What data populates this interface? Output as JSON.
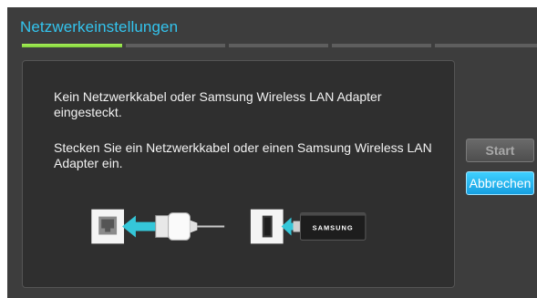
{
  "header": {
    "title": "Netzwerkeinstellungen",
    "progress": {
      "total_steps": 5,
      "current_step": 1
    }
  },
  "message": {
    "line1": "Kein Netzwerkkabel oder Samsung Wireless LAN Adapter eingesteckt.",
    "line2": "Stecken Sie ein Netzwerkkabel oder einen Samsung Wireless LAN Adapter ein."
  },
  "illustration": {
    "adapter_brand": "SAMSUNG",
    "icons": [
      "ethernet-port-icon",
      "network-cable-icon",
      "usb-port-icon",
      "wireless-lan-adapter-icon",
      "arrow-left-icon"
    ]
  },
  "buttons": {
    "start_label": "Start",
    "cancel_label": "Abbrechen"
  },
  "colors": {
    "background": "#3d3d3d",
    "title": "#33c4ee",
    "progress_active": "#9be84e",
    "arrow": "#35c7d9",
    "button_focus": "#1aa9e8"
  }
}
